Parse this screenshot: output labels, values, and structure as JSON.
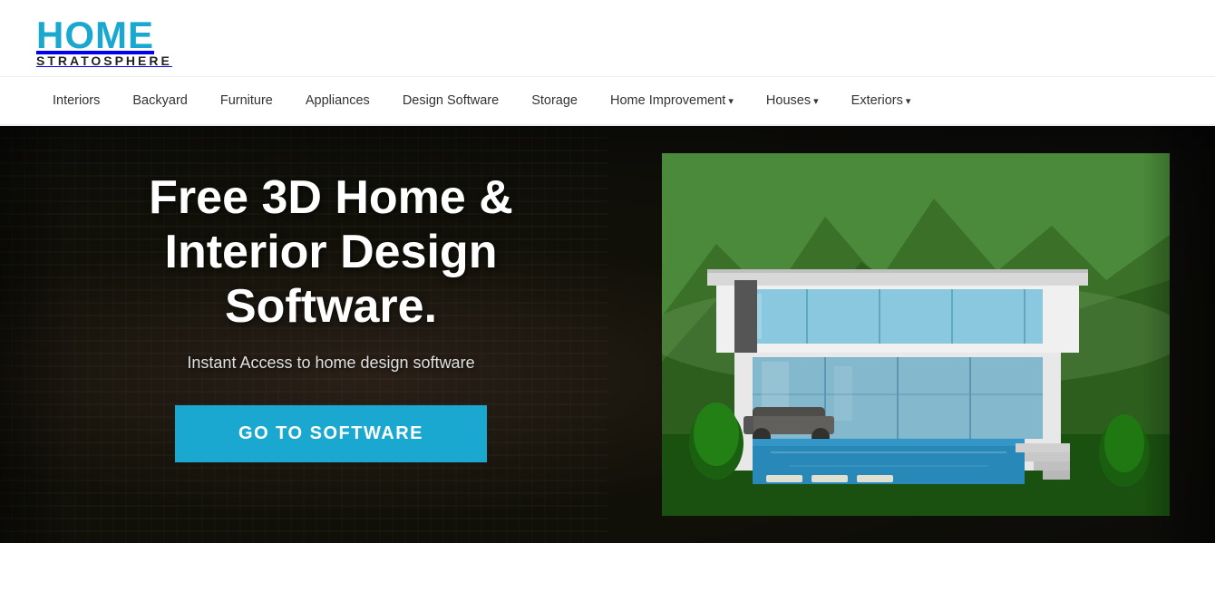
{
  "logo": {
    "home": "HOME",
    "stratosphere": "STRATOSPHERE"
  },
  "nav": {
    "items": [
      {
        "label": "Interiors",
        "hasDropdown": false
      },
      {
        "label": "Backyard",
        "hasDropdown": false
      },
      {
        "label": "Furniture",
        "hasDropdown": false
      },
      {
        "label": "Appliances",
        "hasDropdown": false
      },
      {
        "label": "Design Software",
        "hasDropdown": false
      },
      {
        "label": "Storage",
        "hasDropdown": false
      },
      {
        "label": "Home Improvement",
        "hasDropdown": true
      },
      {
        "label": "Houses",
        "hasDropdown": true
      },
      {
        "label": "Exteriors",
        "hasDropdown": true
      }
    ]
  },
  "hero": {
    "title": "Free 3D Home & Interior Design Software.",
    "subtitle": "Instant Access to home design software",
    "cta_label": "GO TO SOFTWARE",
    "colors": {
      "cta_bg": "#1aa8d0"
    }
  }
}
